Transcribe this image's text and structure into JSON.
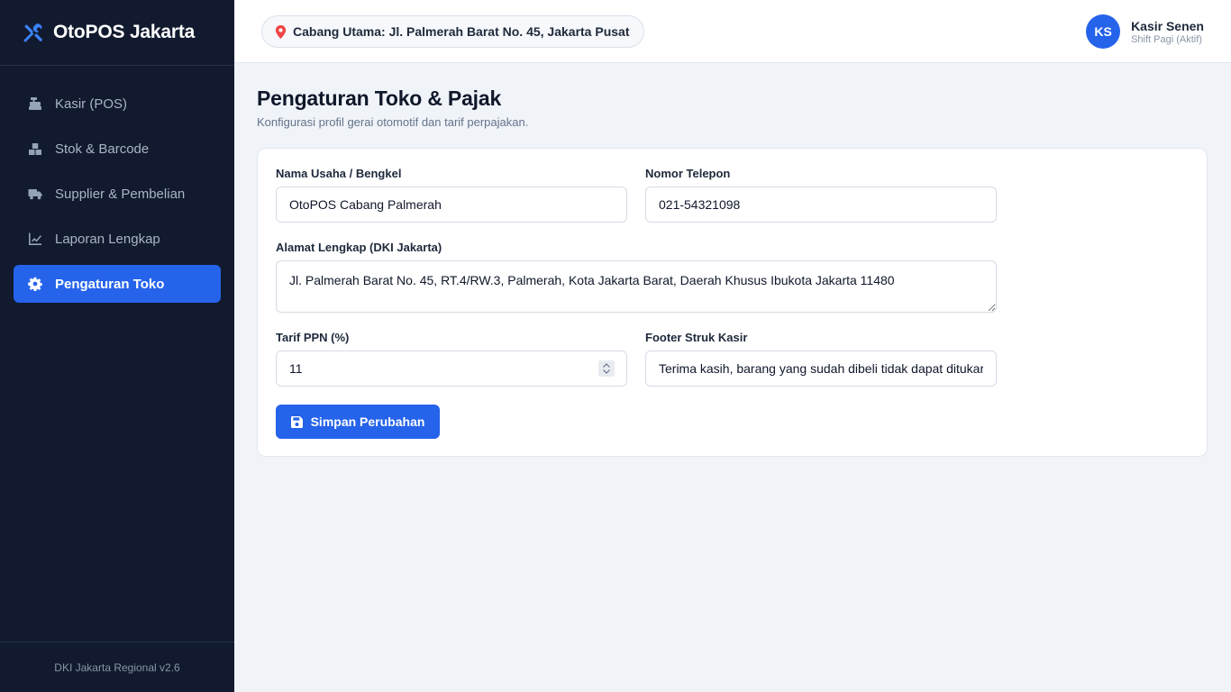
{
  "app": {
    "brand_name": "OtoPOS Jakarta",
    "version_footer": "DKI Jakarta Regional v2.6"
  },
  "sidebar": {
    "items": [
      {
        "label": "Kasir (POS)",
        "icon": "cash-register-icon",
        "active": false
      },
      {
        "label": "Stok & Barcode",
        "icon": "boxes-icon",
        "active": false
      },
      {
        "label": "Supplier & Pembelian",
        "icon": "truck-icon",
        "active": false
      },
      {
        "label": "Laporan Lengkap",
        "icon": "line-chart-icon",
        "active": false
      },
      {
        "label": "Pengaturan Toko",
        "icon": "gear-icon",
        "active": true
      }
    ]
  },
  "header": {
    "branch_label": "Cabang Utama: Jl. Palmerah Barat No. 45, Jakarta Pusat",
    "user": {
      "initials": "KS",
      "name": "Kasir Senen",
      "shift": "Shift Pagi (Aktif)"
    }
  },
  "page": {
    "title": "Pengaturan Toko & Pajak",
    "subtitle": "Konfigurasi profil gerai otomotif dan tarif perpajakan."
  },
  "form": {
    "business_name": {
      "label": "Nama Usaha / Bengkel",
      "value": "OtoPOS Cabang Palmerah"
    },
    "phone": {
      "label": "Nomor Telepon",
      "value": "021-54321098"
    },
    "address": {
      "label": "Alamat Lengkap (DKI Jakarta)",
      "value": "Jl. Palmerah Barat No. 45, RT.4/RW.3, Palmerah, Kota Jakarta Barat, Daerah Khusus Ibukota Jakarta 11480"
    },
    "tax_rate": {
      "label": "Tarif PPN (%)",
      "value": "11"
    },
    "receipt_footer": {
      "label": "Footer Struk Kasir",
      "value": "Terima kasih, barang yang sudah dibeli tidak dapat ditukar"
    },
    "save_label": "Simpan Perubahan"
  },
  "colors": {
    "accent": "#2563eb",
    "sidebar_bg": "#111a2e",
    "page_bg": "#f0f3f8",
    "location_pin": "#ef4444"
  }
}
